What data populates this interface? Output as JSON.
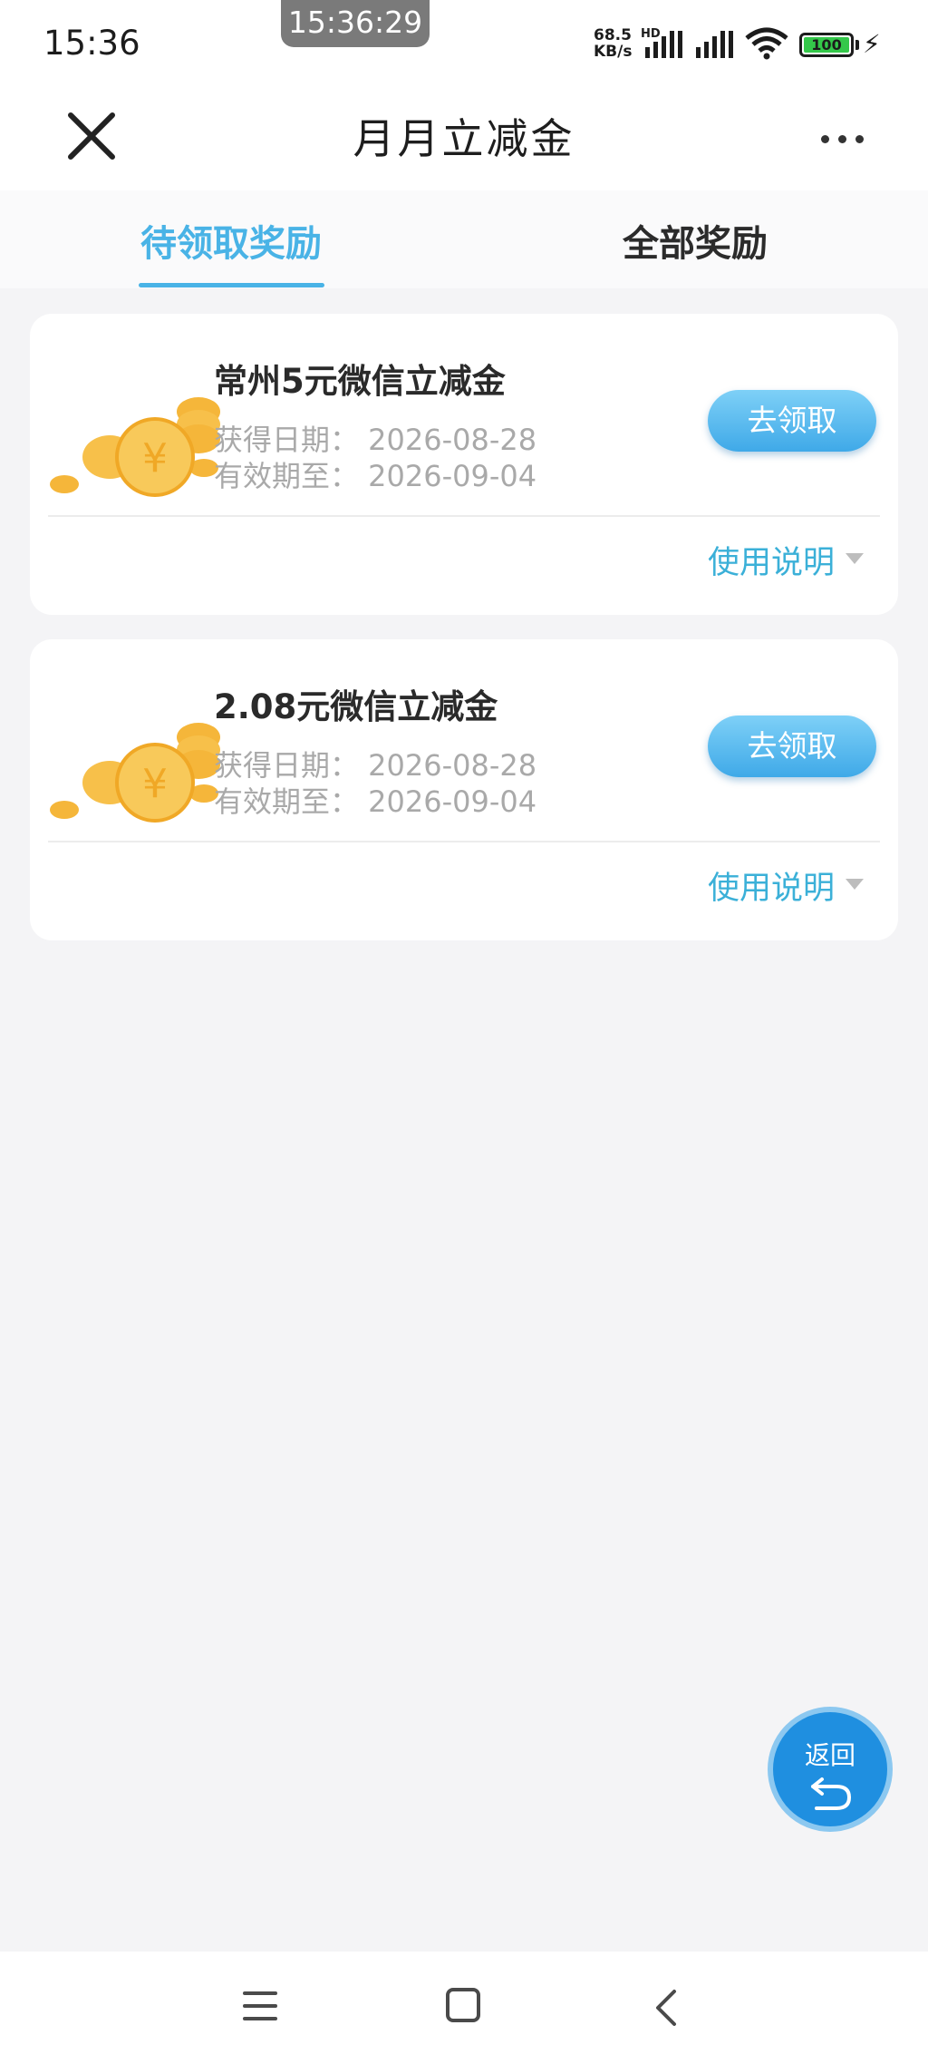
{
  "status_bar": {
    "time": "15:36",
    "recording_time": "15:36:29",
    "net_speed_value": "68.5",
    "net_speed_unit": "KB/s",
    "net_tag": "HD",
    "battery": "100"
  },
  "header": {
    "title": "月月立减金"
  },
  "tabs": [
    {
      "label": "待领取奖励",
      "active": true
    },
    {
      "label": "全部奖励",
      "active": false
    }
  ],
  "rewards": [
    {
      "title": "常州5元微信立减金",
      "obtained": "获得日期：  2026-08-28",
      "valid_until": "有效期至：  2026-09-04",
      "claim_label": "去领取",
      "usage_label": "使用说明"
    },
    {
      "title": "2.08元微信立减金",
      "obtained": "获得日期：  2026-08-28",
      "valid_until": "有效期至：  2026-09-04",
      "claim_label": "去领取",
      "usage_label": "使用说明"
    }
  ],
  "fab": {
    "label": "返回"
  },
  "colors": {
    "accent": "#49b3e6",
    "link": "#3bb0d8",
    "button_top": "#7ed0f7",
    "button_bottom": "#3fa9e8",
    "fab": "#1f8fe0",
    "background": "#f4f4f6"
  },
  "icons": [
    "close-icon",
    "more-icon",
    "coins-icon",
    "caret-down-icon",
    "return-icon",
    "menu-icon",
    "home-icon",
    "back-icon"
  ]
}
